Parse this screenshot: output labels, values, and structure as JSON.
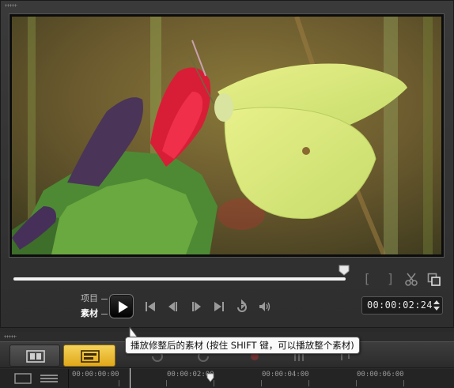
{
  "player": {
    "in_mark": "[",
    "out_mark": "]",
    "scrub_position": 0.99,
    "mode_project": "项目",
    "mode_clip": "素材",
    "timecode": "00:00:02:24"
  },
  "controls": {
    "icons": [
      "play-icon",
      "go-to-start-icon",
      "previous-frame-icon",
      "next-frame-icon",
      "go-to-end-icon",
      "repeat-icon",
      "volume-icon",
      "scissors-icon",
      "copy-icon"
    ]
  },
  "timeline": {
    "ticks": [
      "00:00:00:00",
      "00:00:02:00",
      "00:00:04:00",
      "00:00:06:00"
    ]
  },
  "tooltip": {
    "text": "播放修整后的素材 (按住 SHIFT 键，可以播放整个素材)"
  },
  "colors": {
    "timeline_button": "#f0c030",
    "panel_bg": "#2e2e2e",
    "play_button": "#000000"
  }
}
